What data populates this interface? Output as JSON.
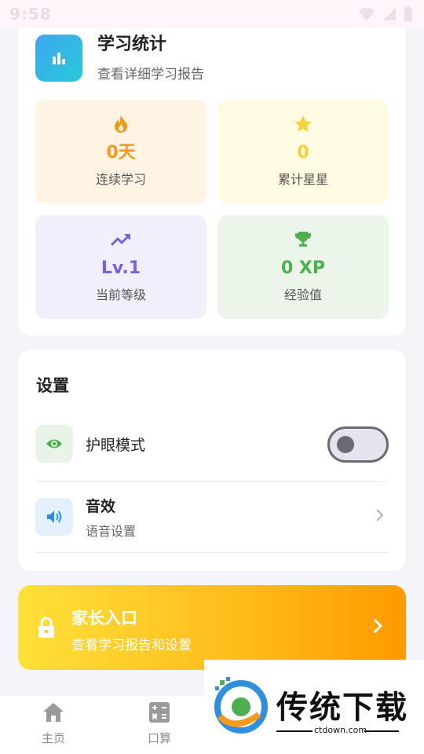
{
  "status_bar": {
    "time": "9:58"
  },
  "stats": {
    "title": "学习统计",
    "subtitle": "查看详细学习报告",
    "tiles": [
      {
        "value": "0天",
        "label": "连续学习",
        "icon": "flame-icon",
        "color": "#f39a1c"
      },
      {
        "value": "0",
        "label": "累计星星",
        "icon": "star-icon",
        "color": "#f6d23a"
      },
      {
        "value": "Lv.1",
        "label": "当前等级",
        "icon": "trending-up-icon",
        "color": "#7a62d6"
      },
      {
        "value": "0 XP",
        "label": "经验值",
        "icon": "trophy-icon",
        "color": "#4caf50"
      }
    ]
  },
  "settings": {
    "title": "设置",
    "eye_mode": {
      "label": "护眼模式",
      "enabled": false
    },
    "sound": {
      "label": "音效",
      "sub": "语音设置"
    }
  },
  "parent_entry": {
    "title": "家长入口",
    "subtitle": "查看学习报告和设置"
  },
  "bottom_nav": [
    {
      "label": "主页",
      "icon": "home-icon"
    },
    {
      "label": "口算",
      "icon": "calculator-icon"
    }
  ],
  "watermark": {
    "text": "传统下载",
    "domain": "ctdown.com"
  }
}
